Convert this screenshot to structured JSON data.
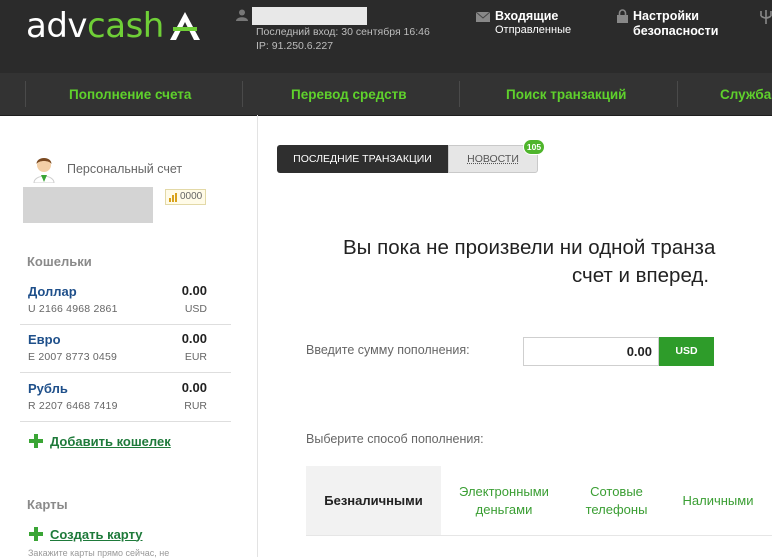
{
  "header": {
    "logo_left": "adv",
    "logo_right": "cash",
    "last_login": "Последний вход: 30 сентября 16:46",
    "ip": "IP: 91.250.6.227",
    "inbox": "Входящие",
    "sent": "Отправленные",
    "security_settings": "Настройки безопасности"
  },
  "nav": {
    "items": [
      "Пополнение счета",
      "Перевод средств",
      "Поиск транзакций",
      "Служба"
    ]
  },
  "sidebar": {
    "account_type": "Персональный счет",
    "rating": "0000",
    "wallets_title": "Кошельки",
    "wallets": [
      {
        "name": "Доллар",
        "number": "U 2166 4968 2861",
        "amount": "0.00",
        "currency": "USD"
      },
      {
        "name": "Евро",
        "number": "E 2007 8773 0459",
        "amount": "0.00",
        "currency": "EUR"
      },
      {
        "name": "Рубль",
        "number": "R 2207 6468 7419",
        "amount": "0.00",
        "currency": "RUR"
      }
    ],
    "add_wallet": "Добавить кошелек",
    "cards_title": "Карты",
    "create_card": "Создать карту",
    "bottom_text": "Закажите карты прямо сейчас, не"
  },
  "main": {
    "tabs": {
      "recent": "ПОСЛЕДНИЕ ТРАНЗАКЦИИ",
      "news": "НОВОСТИ",
      "news_badge": "105"
    },
    "empty_line1": "Вы пока не произвели ни одной транза",
    "empty_line2": "счет и вперед.",
    "amount_label": "Введите сумму пополнения:",
    "amount_value": "0.00",
    "currency_button": "USD",
    "method_label": "Выберите способ пополнения:",
    "methods": [
      "Безналичными",
      "Электронными деньгами",
      "Сотовые телефоны",
      "Наличными"
    ]
  },
  "colors": {
    "header_bg": "#2b2b2b",
    "nav_link": "#5fd12c",
    "accent_green": "#2e9c2a",
    "wallet_name": "#1e4f8a"
  }
}
